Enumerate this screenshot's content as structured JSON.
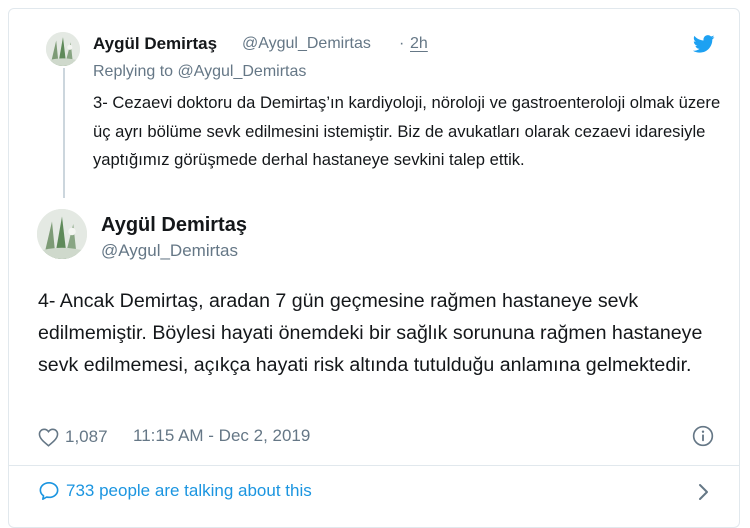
{
  "parent_tweet": {
    "name": "Aygül Demirtaş",
    "handle": "@Aygul_Demirtas",
    "separator": "·",
    "time": "2h",
    "replying_to": "Replying to @Aygul_Demirtas",
    "text": "3- Cezaevi doktoru da Demirtaş’ın kardiyoloji, nöroloji ve gastroenteroloji olmak üzere üç ayrı bölüme sevk edilmesini istemiştir. Biz de avukatları olarak cezaevi idaresiyle yaptığımız görüşmede derhal hastaneye sevkini talep ettik."
  },
  "main_tweet": {
    "name": "Aygül Demirtaş",
    "handle": "@Aygul_Demirtas",
    "text": "4- Ancak Demirtaş, aradan 7 gün geçmesine rağmen hastaneye sevk edilmemiştir. Böylesi hayati önemdeki bir sağlık sorununa rağmen hastaneye sevk edilmemesi, açıkça hayati risk altında tutulduğu anlamına gelmektedir.",
    "likes": "1,087",
    "timestamp": "11:15 AM - Dec 2, 2019"
  },
  "footer": {
    "talking": "733 people are talking about this"
  },
  "colors": {
    "text": "#14171a",
    "secondary": "#657786",
    "twitter_blue": "#1da1f2",
    "link_blue": "#1b95e0",
    "border": "#e1e8ed"
  },
  "icons": [
    "avatar",
    "twitter-logo-icon",
    "heart-icon",
    "info-icon",
    "comment-bubble-icon",
    "chevron-right-icon"
  ]
}
